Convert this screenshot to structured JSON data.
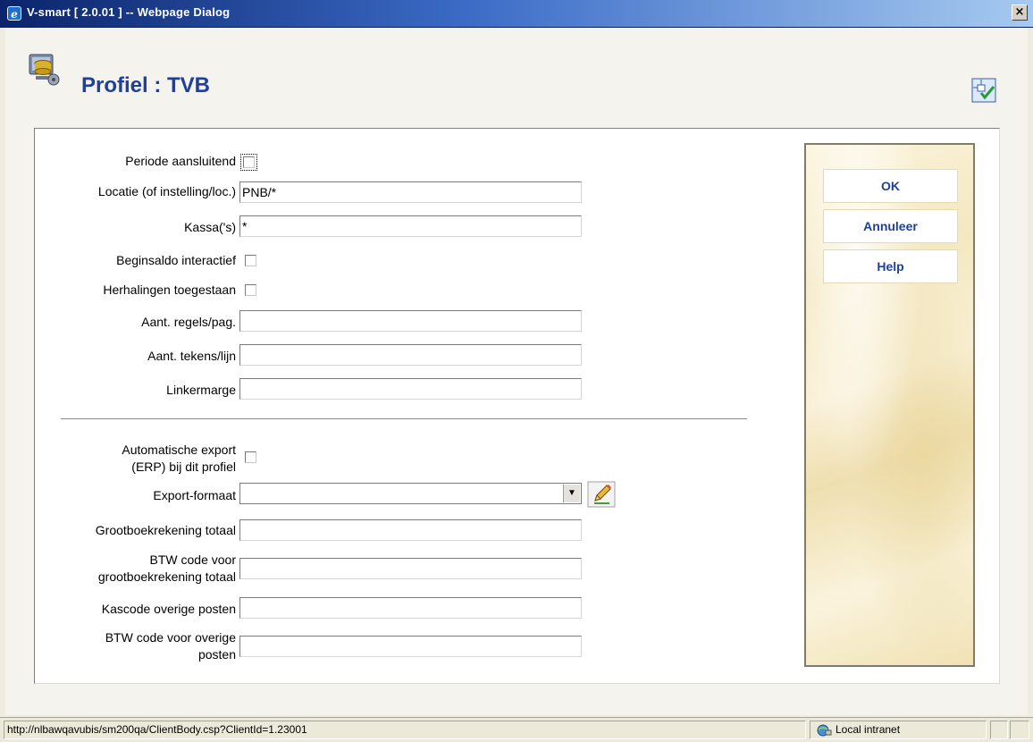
{
  "window": {
    "title": "V-smart [ 2.0.01 ] -- Webpage Dialog",
    "close_label": "×"
  },
  "page": {
    "title": "Profiel : TVB"
  },
  "form": {
    "periode_aansluitend": {
      "label": "Periode aansluitend",
      "checked": false
    },
    "locatie": {
      "label": "Locatie (of instelling/loc.)",
      "value": "PNB/*"
    },
    "kassas": {
      "label": "Kassa('s)",
      "value": "*"
    },
    "beginsaldo": {
      "label": "Beginsaldo interactief",
      "checked": false
    },
    "herhalingen": {
      "label": "Herhalingen toegestaan",
      "checked": false
    },
    "regels": {
      "label": "Aant. regels/pag.",
      "value": ""
    },
    "tekens": {
      "label": "Aant. tekens/lijn",
      "value": ""
    },
    "linkermarge": {
      "label": "Linkermarge",
      "value": ""
    },
    "auto_export": {
      "label_line1": "Automatische export",
      "label_line2": "(ERP) bij dit profiel",
      "checked": false
    },
    "export_formaat": {
      "label": "Export-formaat",
      "value": ""
    },
    "grootboek_totaal": {
      "label": "Grootboekrekening totaal",
      "value": ""
    },
    "btw_grootboek": {
      "label_line1": "BTW code voor",
      "label_line2": "grootboekrekening totaal",
      "value": ""
    },
    "kascode": {
      "label": "Kascode overige posten",
      "value": ""
    },
    "btw_overige": {
      "label_line1": "BTW code voor overige",
      "label_line2": "posten",
      "value": ""
    }
  },
  "actions": {
    "ok": "OK",
    "annuleer": "Annuleer",
    "help": "Help"
  },
  "statusbar": {
    "url": "http://nlbawqavubis/sm200qa/ClientBody.csp?ClientId=1.23001",
    "zone": "Local intranet"
  },
  "colors": {
    "title_blue": "#1f3f9a",
    "titlebar_start": "#0b246a",
    "titlebar_end": "#a6caf0"
  }
}
